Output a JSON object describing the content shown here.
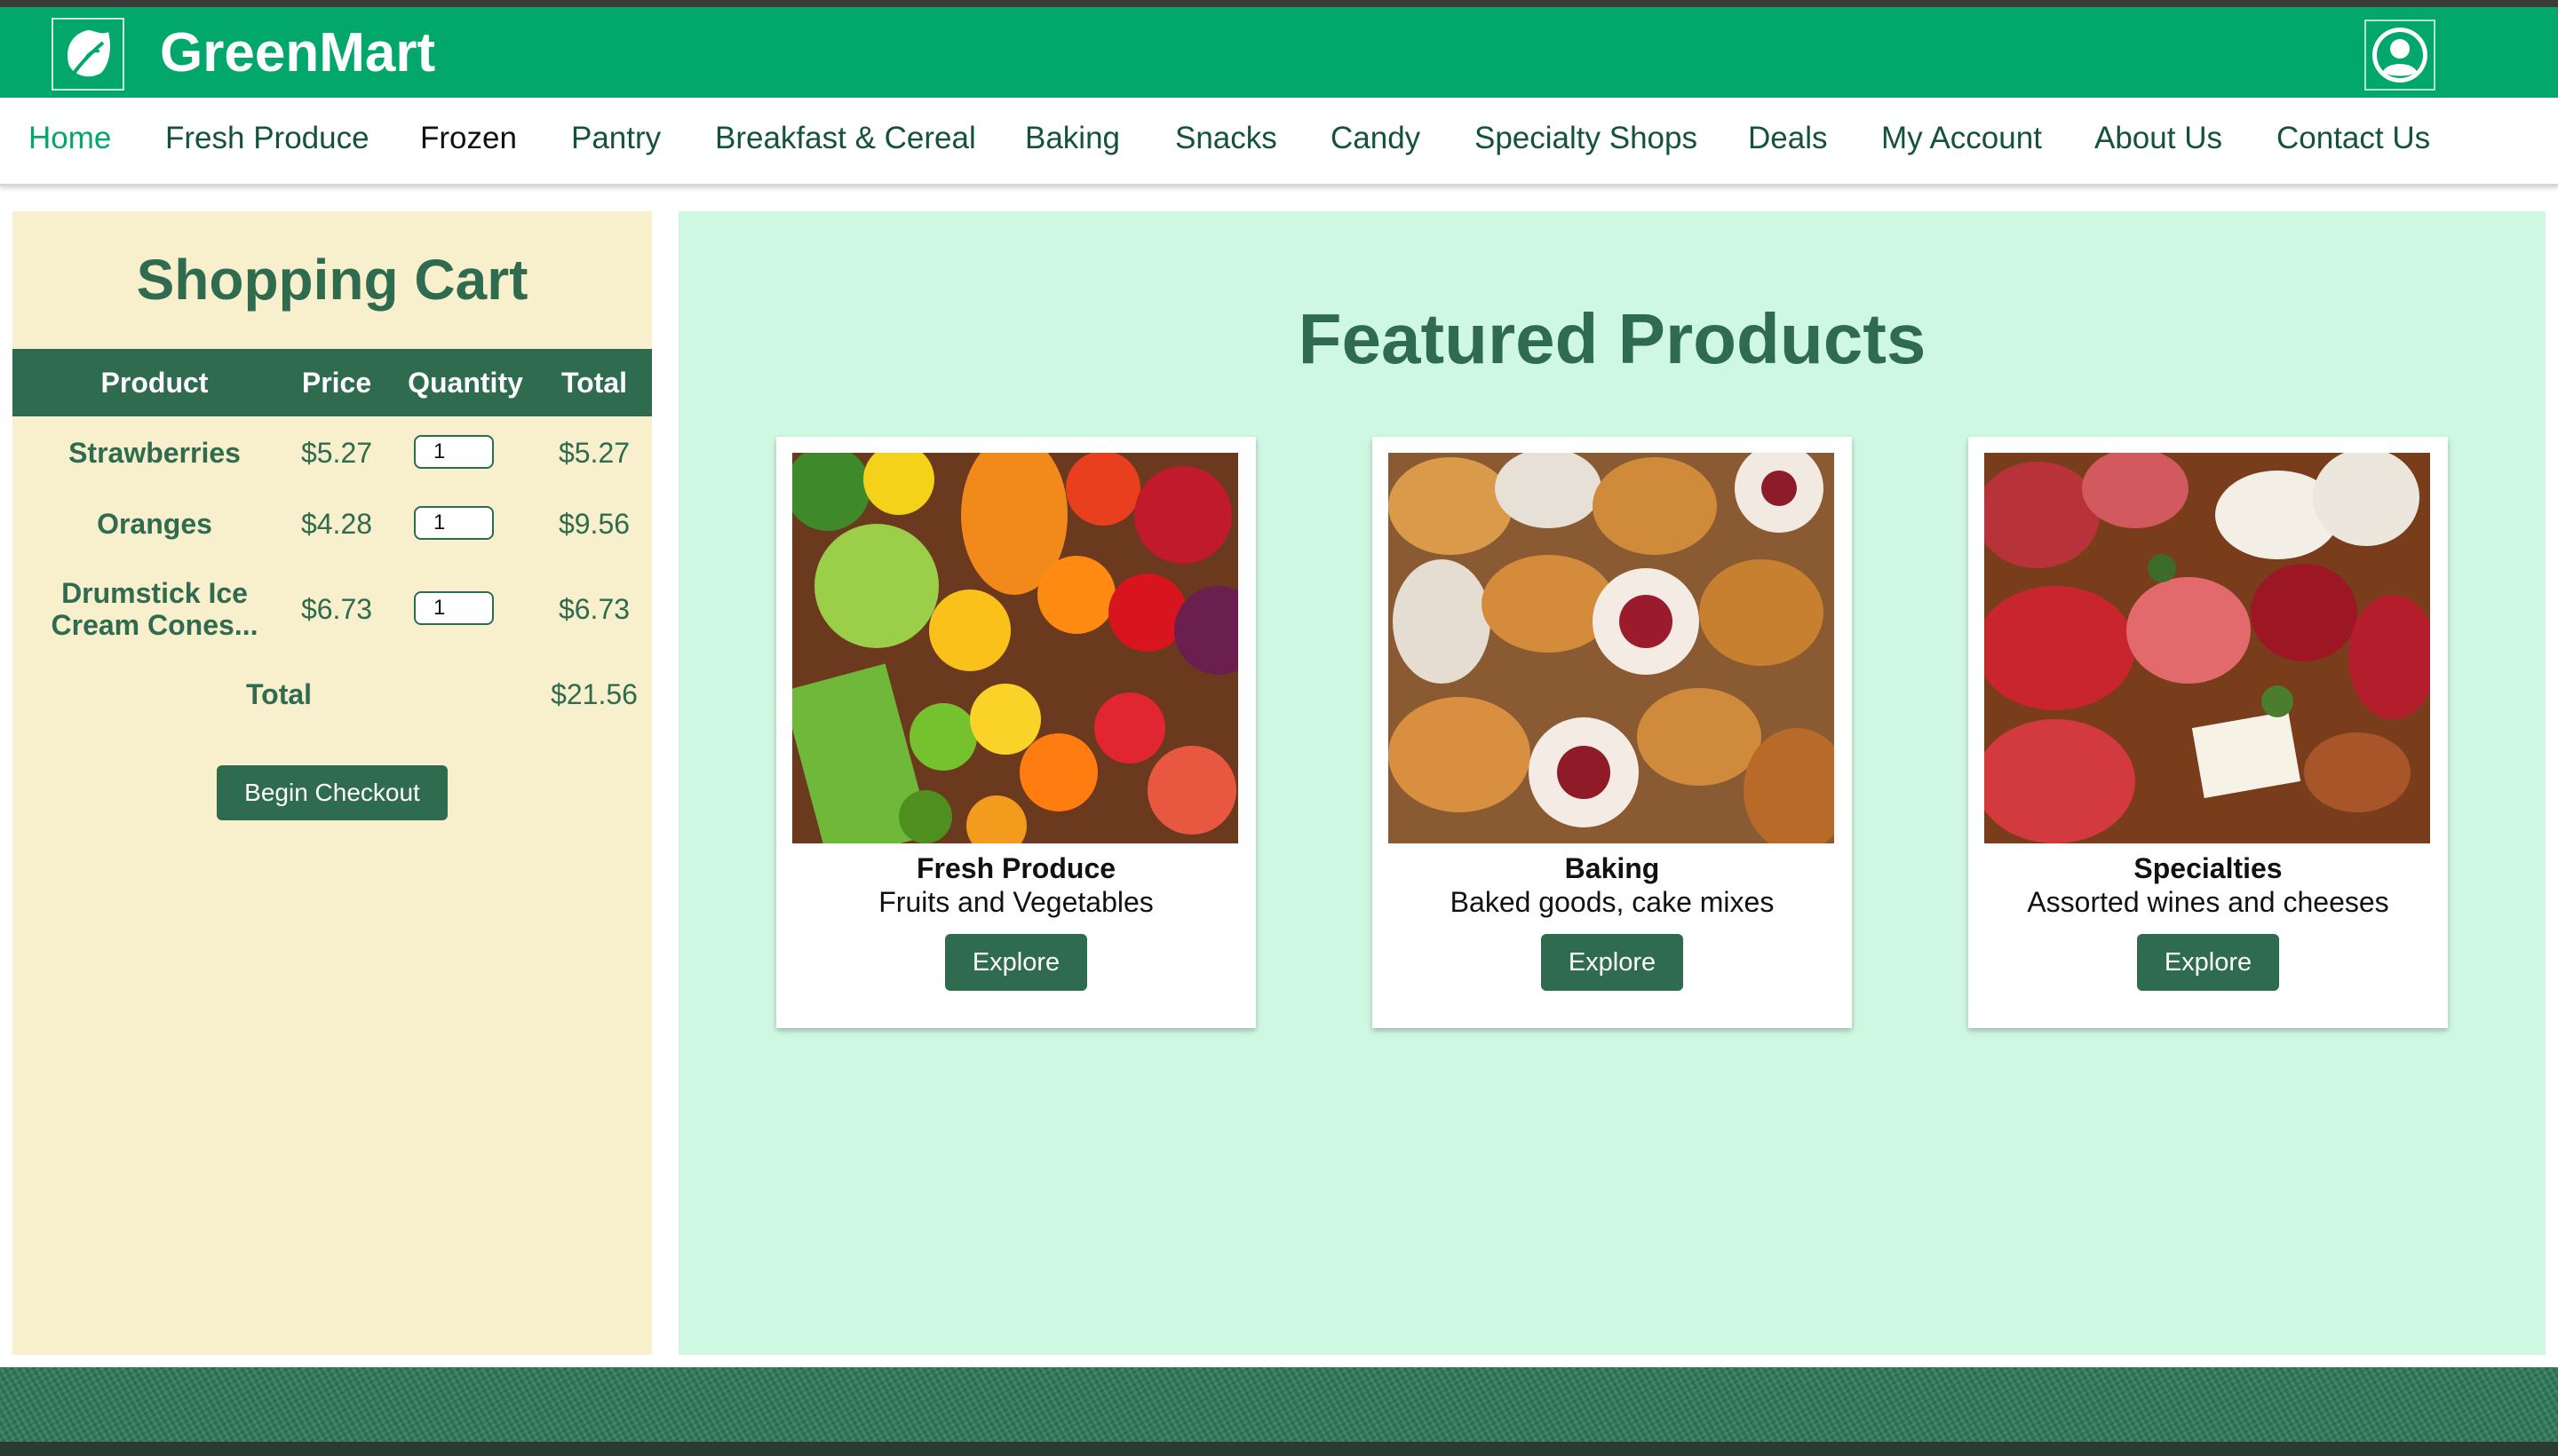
{
  "app": {
    "brand": "GreenMart",
    "colors": {
      "header": "#02a86b",
      "accent": "#2e6b4f",
      "cart_bg": "#f8efcd",
      "featured_bg": "#cff8e2"
    },
    "icons": {
      "logo": "leaf-icon",
      "account": "user-avatar-icon"
    }
  },
  "nav": {
    "items": [
      {
        "label": "Home"
      },
      {
        "label": "Fresh Produce"
      },
      {
        "label": "Frozen"
      },
      {
        "label": "Pantry"
      },
      {
        "label": "Breakfast & Cereal"
      },
      {
        "label": "Baking"
      },
      {
        "label": "Snacks"
      },
      {
        "label": "Candy"
      },
      {
        "label": "Specialty Shops"
      },
      {
        "label": "Deals"
      },
      {
        "label": "My Account"
      },
      {
        "label": "About Us"
      },
      {
        "label": "Contact Us"
      }
    ]
  },
  "cart": {
    "title": "Shopping Cart",
    "columns": [
      "Product",
      "Price",
      "Quantity",
      "Total"
    ],
    "rows": [
      {
        "product": "Strawberries",
        "price": "$5.27",
        "quantity": "1",
        "total": "$5.27"
      },
      {
        "product": "Oranges",
        "price": "$4.28",
        "quantity": "1",
        "total": "$9.56"
      },
      {
        "product_line1": "Drumstick Ice",
        "product_line2": "Cream Cones...",
        "price": "$6.73",
        "quantity": "1",
        "total": "$6.73"
      }
    ],
    "total_label": "Total",
    "total_value": "$21.56",
    "checkout_label": "Begin Checkout"
  },
  "featured": {
    "title": "Featured Products",
    "cards": [
      {
        "title": "Fresh Produce",
        "subtitle": "Fruits and Vegetables",
        "button": "Explore"
      },
      {
        "title": "Baking",
        "subtitle": "Baked goods, cake mixes",
        "button": "Explore"
      },
      {
        "title": "Specialties",
        "subtitle": "Assorted wines and cheeses",
        "button": "Explore"
      }
    ]
  }
}
